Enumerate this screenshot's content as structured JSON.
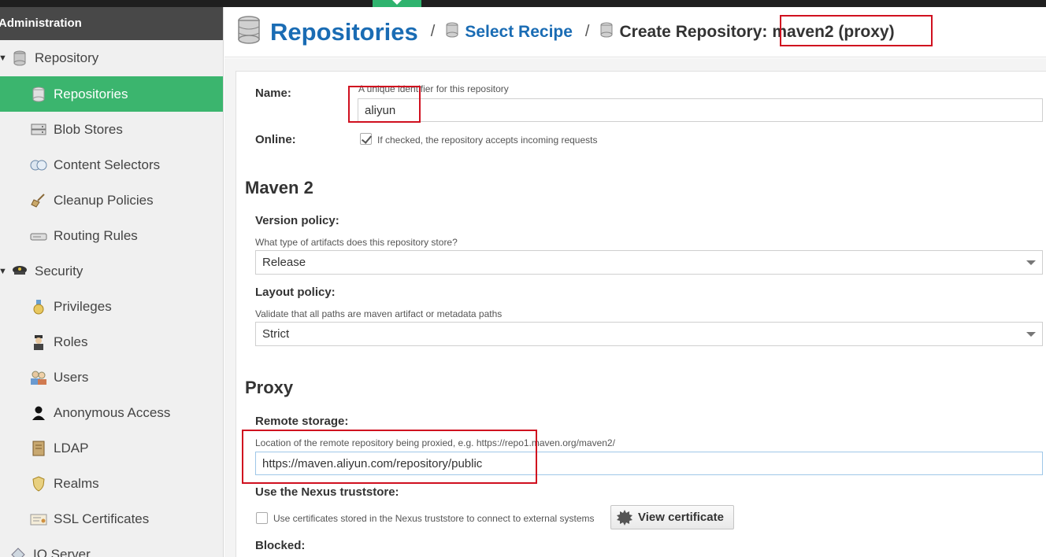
{
  "sidebar": {
    "header": "Administration",
    "items": [
      {
        "label": "Repository",
        "icon": "database-icon",
        "type": "group"
      },
      {
        "label": "Repositories",
        "icon": "database-icon",
        "type": "child",
        "active": true
      },
      {
        "label": "Blob Stores",
        "icon": "server-icon",
        "type": "child"
      },
      {
        "label": "Content Selectors",
        "icon": "content-selector-icon",
        "type": "child"
      },
      {
        "label": "Cleanup Policies",
        "icon": "broom-icon",
        "type": "child"
      },
      {
        "label": "Routing Rules",
        "icon": "router-icon",
        "type": "child"
      },
      {
        "label": "Security",
        "icon": "police-hat-icon",
        "type": "group"
      },
      {
        "label": "Privileges",
        "icon": "medal-icon",
        "type": "child"
      },
      {
        "label": "Roles",
        "icon": "officer-icon",
        "type": "child"
      },
      {
        "label": "Users",
        "icon": "users-icon",
        "type": "child"
      },
      {
        "label": "Anonymous Access",
        "icon": "user-silhouette-icon",
        "type": "child"
      },
      {
        "label": "LDAP",
        "icon": "address-book-icon",
        "type": "child"
      },
      {
        "label": "Realms",
        "icon": "shield-icon",
        "type": "child"
      },
      {
        "label": "SSL Certificates",
        "icon": "certificate-icon",
        "type": "child"
      },
      {
        "label": "IQ Server",
        "icon": "iq-server-icon",
        "type": "group"
      }
    ]
  },
  "header": {
    "title": "Repositories",
    "separator": "/",
    "crumb1": "Select Recipe",
    "crumb2_prefix": "Create Repository:",
    "crumb2_recipe": "maven2 (proxy)"
  },
  "form": {
    "name_label": "Name:",
    "name_help": "A unique identifier for this repository",
    "name_value": "aliyun",
    "online_label": "Online:",
    "online_checked": true,
    "online_help": "If checked, the repository accepts incoming requests",
    "maven_section": "Maven 2",
    "version_policy_label": "Version policy:",
    "version_policy_help": "What type of artifacts does this repository store?",
    "version_policy_value": "Release",
    "layout_policy_label": "Layout policy:",
    "layout_policy_help": "Validate that all paths are maven artifact or metadata paths",
    "layout_policy_value": "Strict",
    "proxy_section": "Proxy",
    "remote_storage_label": "Remote storage:",
    "remote_storage_help": "Location of the remote repository being proxied, e.g. https://repo1.maven.org/maven2/",
    "remote_storage_value": "https://maven.aliyun.com/repository/public",
    "truststore_label": "Use the Nexus truststore:",
    "truststore_checked": false,
    "truststore_help": "Use certificates stored in the Nexus truststore to connect to external systems",
    "view_certificate_button": "View certificate",
    "blocked_label": "Blocked:"
  },
  "colors": {
    "active_green": "#3bb56e",
    "link_blue": "#1a6cb4",
    "annotation_red": "#d0101f"
  }
}
